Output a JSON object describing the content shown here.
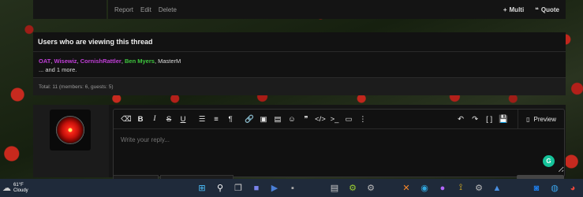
{
  "post_actions": {
    "report": "Report",
    "edit": "Edit",
    "delete": "Delete",
    "multi": "Multi",
    "quote": "Quote"
  },
  "viewers": {
    "title": "Users who are viewing this thread",
    "users": [
      {
        "name": "OAT",
        "color": "purple"
      },
      {
        "name": "Wisewiz",
        "color": "purple"
      },
      {
        "name": "CornishRattler",
        "color": "purple"
      },
      {
        "name": "Ben Myers",
        "color": "green"
      },
      {
        "name": "MasterM",
        "color": "plain"
      }
    ],
    "more": "... and 1 more.",
    "total": "Total: 11 (members: 6, guests: 5)"
  },
  "editor": {
    "placeholder": "Write your reply...",
    "preview_label": "Preview",
    "toolbar": [
      "eraser-icon",
      "bold-icon",
      "italic-icon",
      "strikethrough-icon",
      "underline-icon",
      "list-icon",
      "align-icon",
      "paragraph-icon",
      "link-icon",
      "image-icon",
      "media-icon",
      "emoji-icon",
      "quote-icon",
      "code-icon",
      "inline-code-icon",
      "spoiler-icon",
      "more-icon"
    ],
    "toolbar_right": [
      "undo-icon",
      "redo-icon",
      "bbcode-toggle-icon",
      "drafts-icon"
    ]
  },
  "taskbar": {
    "temperature": "61°F",
    "condition": "Cloudy"
  },
  "colors": {
    "username_purple": "#c13fd8",
    "username_green": "#3ec63e",
    "grammarly": "#15c39a"
  }
}
